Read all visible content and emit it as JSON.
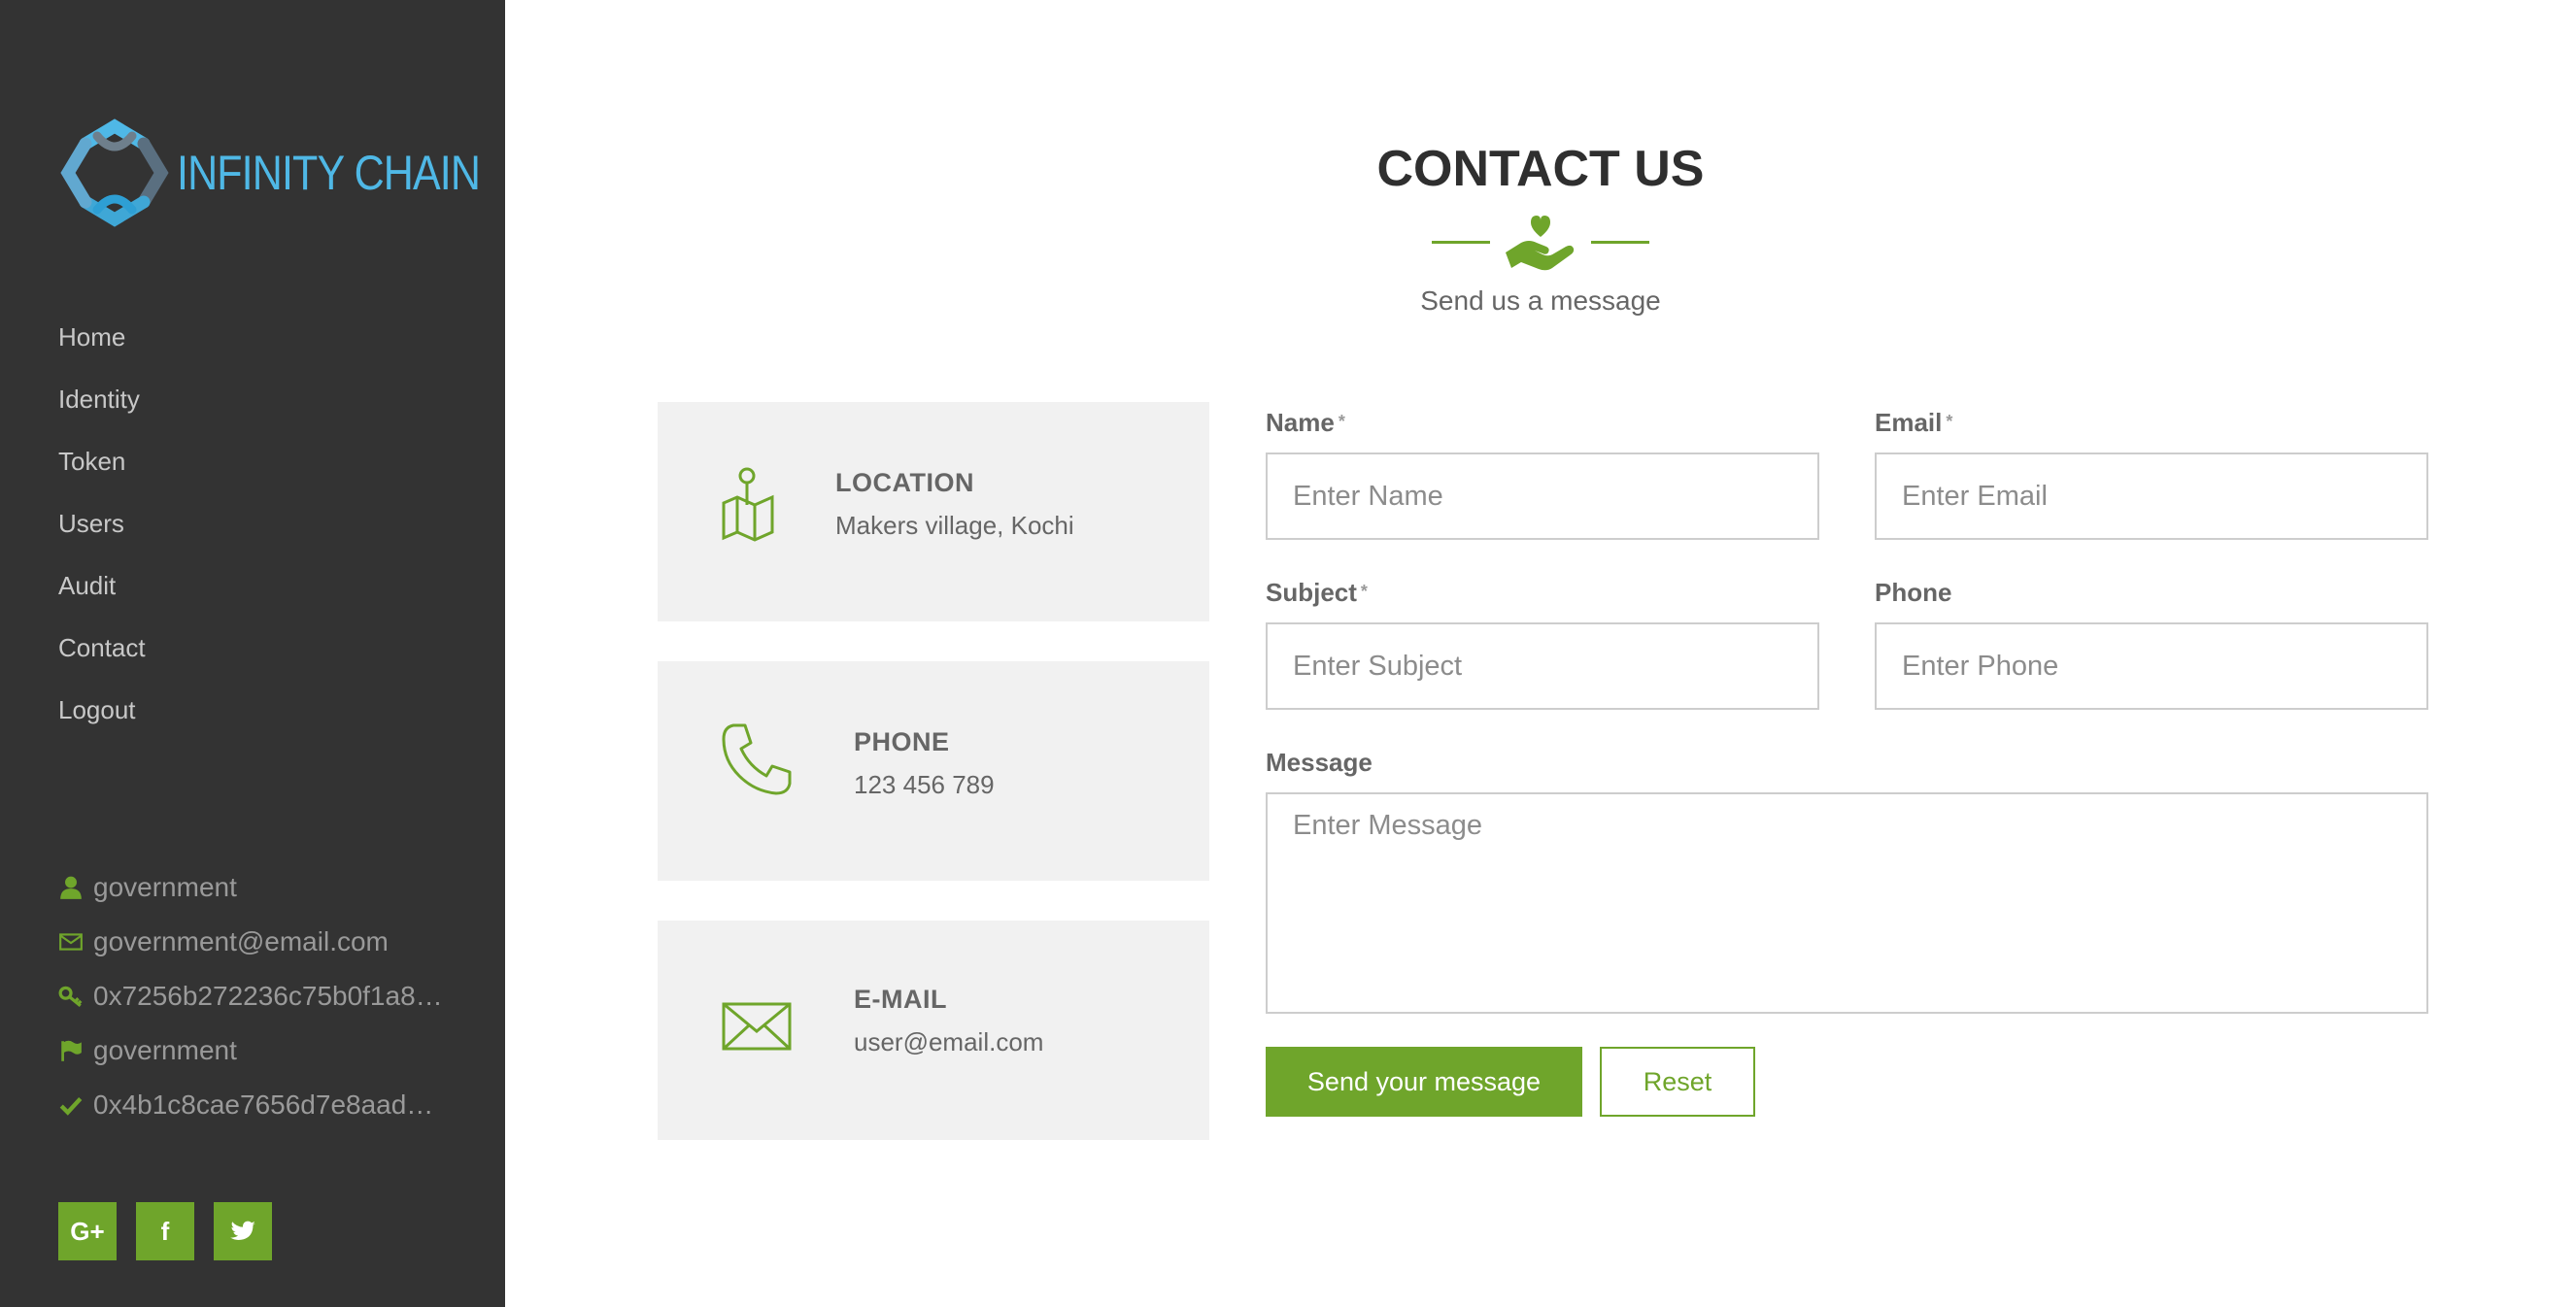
{
  "brand": {
    "name": "INFINITY CHAIN",
    "color": "#4fb8e6"
  },
  "sidebar": {
    "nav": [
      "Home",
      "Identity",
      "Token",
      "Users",
      "Audit",
      "Contact",
      "Logout"
    ],
    "user": {
      "name": "government",
      "email": "government@email.com",
      "key": "0x7256b272236c75b0f1a8…",
      "role": "government",
      "verified": "0x4b1c8cae7656d7e8aad…"
    },
    "socials": [
      {
        "icon": "google-plus-icon",
        "label": "G+"
      },
      {
        "icon": "facebook-icon",
        "label": "f"
      },
      {
        "icon": "twitter-icon",
        "label": ""
      }
    ]
  },
  "page": {
    "title": "CONTACT US",
    "subtitle": "Send us a message",
    "accent": "#6fa52b"
  },
  "cards": [
    {
      "icon": "map-icon",
      "title": "LOCATION",
      "value": "Makers village, Kochi"
    },
    {
      "icon": "phone-icon",
      "title": "PHONE",
      "value": "123 456 789"
    },
    {
      "icon": "envelope-icon",
      "title": "E-MAIL",
      "value": "user@email.com"
    }
  ],
  "form": {
    "name": {
      "label": "Name",
      "required": "*",
      "placeholder": "Enter Name"
    },
    "email": {
      "label": "Email",
      "required": "*",
      "placeholder": "Enter Email"
    },
    "subject": {
      "label": "Subject",
      "required": "*",
      "placeholder": "Enter Subject"
    },
    "phone": {
      "label": "Phone",
      "placeholder": "Enter Phone"
    },
    "message": {
      "label": "Message",
      "placeholder": "Enter Message"
    },
    "send_label": "Send your message",
    "reset_label": "Reset"
  }
}
